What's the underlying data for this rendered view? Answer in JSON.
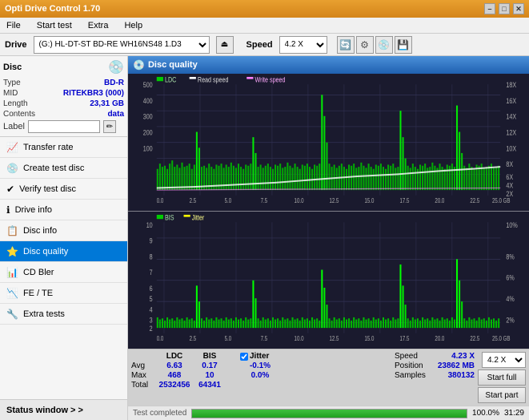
{
  "titleBar": {
    "title": "Opti Drive Control 1.70",
    "minimizeBtn": "–",
    "maximizeBtn": "□",
    "closeBtn": "✕"
  },
  "menuBar": {
    "items": [
      "File",
      "Start test",
      "Extra",
      "Help"
    ]
  },
  "driveBar": {
    "label": "Drive",
    "driveValue": "(G:)  HL-DT-ST BD-RE  WH16NS48 1.D3",
    "speedLabel": "Speed",
    "speedValue": "4.2 X"
  },
  "disc": {
    "title": "Disc",
    "type": {
      "key": "Type",
      "val": "BD-R"
    },
    "mid": {
      "key": "MID",
      "val": "RITEKBR3 (000)"
    },
    "length": {
      "key": "Length",
      "val": "23,31 GB"
    },
    "contents": {
      "key": "Contents",
      "val": "data"
    },
    "labelKey": "Label",
    "labelVal": ""
  },
  "navItems": [
    {
      "label": "Transfer rate",
      "icon": "📈",
      "active": false
    },
    {
      "label": "Create test disc",
      "icon": "💿",
      "active": false
    },
    {
      "label": "Verify test disc",
      "icon": "✔",
      "active": false
    },
    {
      "label": "Drive info",
      "icon": "ℹ",
      "active": false
    },
    {
      "label": "Disc info",
      "icon": "📋",
      "active": false
    },
    {
      "label": "Disc quality",
      "icon": "⭐",
      "active": true
    },
    {
      "label": "CD Bler",
      "icon": "📊",
      "active": false
    },
    {
      "label": "FE / TE",
      "icon": "📉",
      "active": false
    },
    {
      "label": "Extra tests",
      "icon": "🔧",
      "active": false
    }
  ],
  "statusWindow": {
    "label": "Status window > >"
  },
  "discQuality": {
    "title": "Disc quality"
  },
  "legend1": {
    "ldc": "LDC",
    "readSpeed": "Read speed",
    "writeSpeed": "Write speed"
  },
  "legend2": {
    "bis": "BIS",
    "jitter": "Jitter"
  },
  "stats": {
    "columns": [
      "",
      "LDC",
      "BIS",
      "",
      "Jitter",
      "Speed",
      ""
    ],
    "avg": {
      "label": "Avg",
      "ldc": "6.63",
      "bis": "0.17",
      "jitter": "-0.1%",
      "speed": "4.23 X",
      "speedDrop": "4.2 X"
    },
    "max": {
      "label": "Max",
      "ldc": "468",
      "bis": "10",
      "jitter": "0.0%",
      "position": "23862 MB"
    },
    "total": {
      "label": "Total",
      "ldc": "2532456",
      "bis": "64341",
      "samples": "380132"
    },
    "jitterChecked": true,
    "jitterLabel": "Jitter",
    "speedLabel": "Speed",
    "positionLabel": "Position",
    "samplesLabel": "Samples"
  },
  "buttons": {
    "startFull": "Start full",
    "startPart": "Start part"
  },
  "progressBar": {
    "percent": 100,
    "percentText": "100.0%",
    "status": "Test completed",
    "time": "31:29"
  },
  "chartTop": {
    "yMax": 500,
    "yMin": 0,
    "rightAxis": {
      "values": [
        "18X",
        "16X",
        "14X",
        "12X",
        "10X",
        "8X",
        "6X",
        "4X",
        "2X"
      ]
    },
    "xAxis": {
      "values": [
        "0.0",
        "2.5",
        "5.0",
        "7.5",
        "10.0",
        "12.5",
        "15.0",
        "17.5",
        "20.0",
        "22.5",
        "25.0 GB"
      ]
    }
  },
  "chartBot": {
    "yMax": 10,
    "yMin": 0,
    "rightAxis": {
      "values": [
        "10%",
        "8%",
        "6%",
        "4%",
        "2%"
      ]
    },
    "xAxis": {
      "values": [
        "0.0",
        "2.5",
        "5.0",
        "7.5",
        "10.0",
        "12.5",
        "15.0",
        "17.5",
        "20.0",
        "22.5",
        "25.0 GB"
      ]
    }
  }
}
